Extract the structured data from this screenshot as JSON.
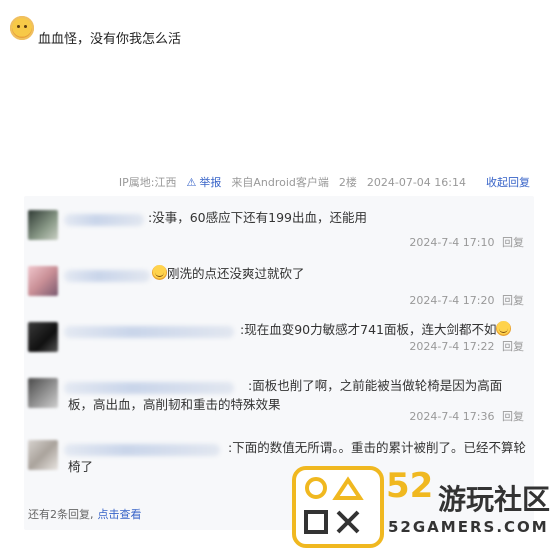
{
  "post": {
    "text": "血血怪，没有你我怎么活"
  },
  "meta": {
    "ip": "IP属地:江西",
    "report": "举报",
    "client": "来自Android客户端",
    "floor": "2楼",
    "time": "2024-07-04 16:14",
    "collapse": "收起回复"
  },
  "replies": [
    {
      "content": ":没事，60感应下还有199出血，还能用",
      "time": "2024-7-4 17:10",
      "reply": "回复",
      "smiley": false
    },
    {
      "content": "刚洗的点还没爽过就砍了",
      "time": "2024-7-4 17:20",
      "reply": "回复",
      "smiley": true
    },
    {
      "content": ":现在血变90力敏感才741面板，连大剑都不如",
      "time": "2024-7-4 17:22",
      "reply": "回复",
      "smiley": true
    },
    {
      "content": ":面板也削了啊，之前能被当做轮椅是因为高面板，高出血，高削韧和重击的特殊效果",
      "time": "2024-7-4 17:36",
      "reply": "回复",
      "smiley": false
    },
    {
      "content": ":下面的数值无所谓。。重击的累计被削了。已经不算轮椅了",
      "time": "",
      "reply": "",
      "smiley": false
    }
  ],
  "more": {
    "text": "还有2条回复,",
    "link": "点击查看"
  },
  "watermark": {
    "brand_number": "52",
    "brand_name": "游玩社区",
    "url": "52GAMERS.COM"
  },
  "colors": {
    "link": "#3864c8",
    "muted": "#999999",
    "reply_bg": "#f7f8fa",
    "brand_yellow": "#f0b820"
  }
}
